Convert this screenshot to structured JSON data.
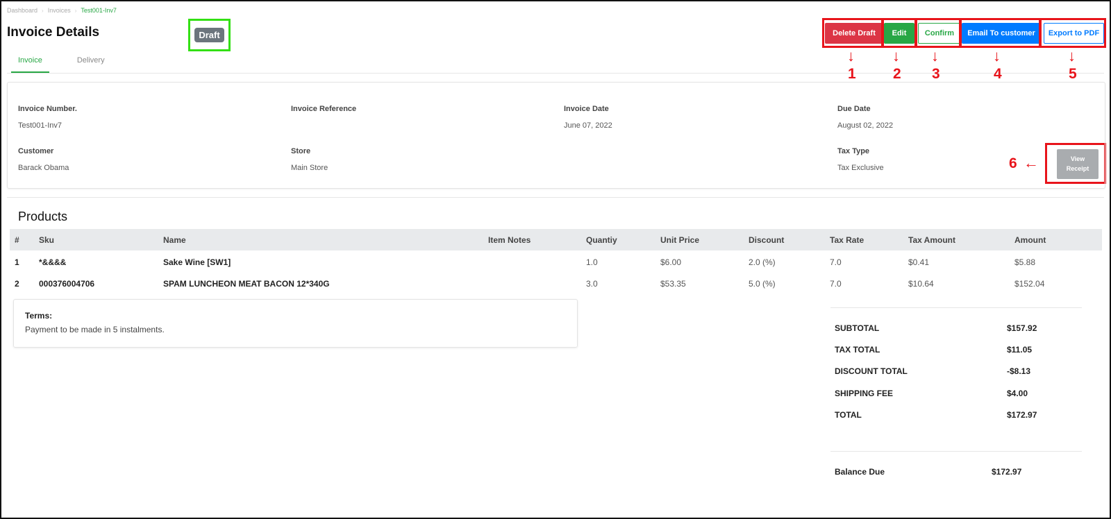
{
  "breadcrumb": [
    "Dashboard",
    "Invoices",
    "Test001-Inv7"
  ],
  "page_title": "Invoice Details",
  "status_badge": "Draft",
  "tabs": [
    {
      "label": "Invoice",
      "active": true
    },
    {
      "label": "Delivery",
      "active": false
    }
  ],
  "actions": {
    "delete": "Delete Draft",
    "edit": "Edit",
    "confirm": "Confirm",
    "email": "Email To customer",
    "pdf": "Export to PDF"
  },
  "annotations": [
    "1",
    "2",
    "3",
    "4",
    "5",
    "6"
  ],
  "details": {
    "invoice_number_label": "Invoice Number.",
    "invoice_number": "Test001-Inv7",
    "invoice_reference_label": "Invoice Reference",
    "invoice_reference": "",
    "invoice_date_label": "Invoice Date",
    "invoice_date": "June 07, 2022",
    "due_date_label": "Due Date",
    "due_date": "August 02, 2022",
    "customer_label": "Customer",
    "customer": "Barack Obama",
    "store_label": "Store",
    "store": "Main Store",
    "tax_type_label": "Tax Type",
    "tax_type": "Tax Exclusive",
    "view_receipt_line1": "View",
    "view_receipt_line2": "Receipt"
  },
  "products": {
    "title": "Products",
    "columns": [
      "#",
      "Sku",
      "Name",
      "Item Notes",
      "Quantiy",
      "Unit Price",
      "Discount",
      "Tax Rate",
      "Tax Amount",
      "Amount"
    ],
    "rows": [
      [
        "1",
        "*&&&&",
        "Sake Wine [SW1]",
        "",
        "1.0",
        "$6.00",
        "2.0 (%)",
        "7.0",
        "$0.41",
        "$5.88"
      ],
      [
        "2",
        "000376004706",
        "SPAM LUNCHEON MEAT BACON 12*340G",
        "",
        "3.0",
        "$53.35",
        "5.0 (%)",
        "7.0",
        "$10.64",
        "$152.04"
      ]
    ]
  },
  "terms": {
    "title": "Terms:",
    "body": "Payment to be made in 5 instalments."
  },
  "totals": {
    "subtotal_label": "SUBTOTAL",
    "subtotal": "$157.92",
    "tax_total_label": "TAX TOTAL",
    "tax_total": "$11.05",
    "discount_total_label": "DISCOUNT TOTAL",
    "discount_total": "-$8.13",
    "shipping_fee_label": "SHIPPING FEE",
    "shipping_fee": "$4.00",
    "total_label": "TOTAL",
    "total": "$172.97",
    "balance_due_label": "Balance Due",
    "balance_due": "$172.97"
  },
  "colors": {
    "danger": "#dc3545",
    "success": "#28a745",
    "primary": "#007bff",
    "secondary": "#6c757d",
    "annotation_red": "#e8141b",
    "annotation_green": "#33e014"
  }
}
